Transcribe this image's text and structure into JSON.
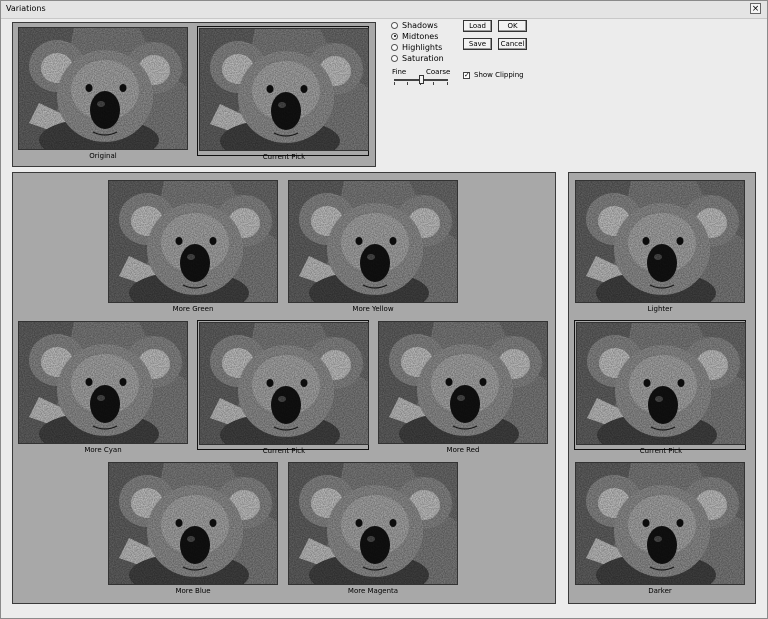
{
  "window": {
    "title": "Variations",
    "close_glyph": "×"
  },
  "options": {
    "radios": [
      {
        "label": "Shadows",
        "selected": false
      },
      {
        "label": "Midtones",
        "selected": true
      },
      {
        "label": "Highlights",
        "selected": false
      },
      {
        "label": "Saturation",
        "selected": false
      }
    ],
    "fine_label": "Fine",
    "coarse_label": "Coarse",
    "slider_value": 0.5,
    "show_clipping_label": "Show Clipping",
    "show_clipping_checked": true
  },
  "buttons": {
    "load": "Load",
    "ok": "OK",
    "save": "Save",
    "cancel": "Cancel"
  },
  "top_panel": {
    "original": "Original",
    "current_pick": "Current Pick"
  },
  "color_panel": {
    "more_green": "More Green",
    "more_yellow": "More Yellow",
    "more_cyan": "More Cyan",
    "current_pick": "Current Pick",
    "more_red": "More Red",
    "more_blue": "More Blue",
    "more_magenta": "More Magenta"
  },
  "light_panel": {
    "lighter": "Lighter",
    "current_pick": "Current Pick",
    "darker": "Darker"
  }
}
